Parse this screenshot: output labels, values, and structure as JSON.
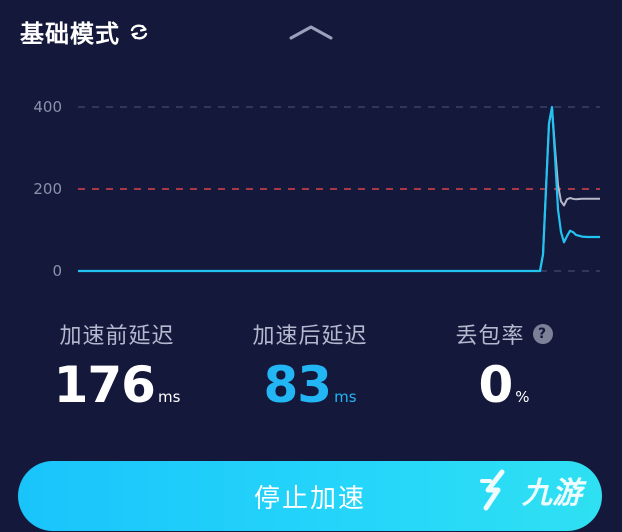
{
  "header": {
    "mode_title": "基础模式"
  },
  "chart_data": {
    "type": "line",
    "y_ticks": [
      "400",
      "200",
      "0"
    ],
    "ylim": [
      0,
      400
    ],
    "threshold": 200,
    "series": [
      {
        "color": "#b7b9c9",
        "x": [
          0,
          10,
          20,
          30,
          40,
          50,
          60,
          70,
          80,
          90,
          100,
          110,
          120,
          125,
          130,
          135,
          140,
          145,
          150,
          155,
          160,
          165,
          170,
          175,
          180,
          190,
          200,
          210,
          220
        ],
        "values": [
          0,
          0,
          0,
          0,
          0,
          0,
          0,
          0,
          0,
          0,
          0,
          0,
          0,
          40,
          200,
          360,
          398,
          300,
          210,
          170,
          160,
          175,
          178,
          176,
          175,
          176,
          176,
          176,
          176
        ]
      },
      {
        "color": "#22c3f0",
        "x": [
          0,
          10,
          20,
          30,
          40,
          50,
          60,
          70,
          80,
          90,
          100,
          110,
          120,
          125,
          130,
          135,
          140,
          145,
          150,
          155,
          160,
          165,
          170,
          175,
          180,
          190,
          200,
          210,
          220
        ],
        "values": [
          0,
          0,
          0,
          0,
          0,
          0,
          0,
          0,
          0,
          0,
          0,
          0,
          0,
          40,
          200,
          360,
          400,
          280,
          150,
          95,
          70,
          85,
          98,
          95,
          88,
          84,
          83,
          83,
          83
        ]
      }
    ]
  },
  "stats": {
    "before": {
      "label": "加速前延迟",
      "value": "176",
      "unit": "ms"
    },
    "after": {
      "label": "加速后延迟",
      "value": "83",
      "unit": "ms"
    },
    "loss": {
      "label": "丢包率",
      "value": "0",
      "unit": "%",
      "help": "?"
    }
  },
  "button": {
    "stop_label": "停止加速"
  },
  "watermark": {
    "text": "九游"
  },
  "colors": {
    "background": "#14183a",
    "accent": "#23b6f5",
    "threshold": "#d9434b"
  }
}
